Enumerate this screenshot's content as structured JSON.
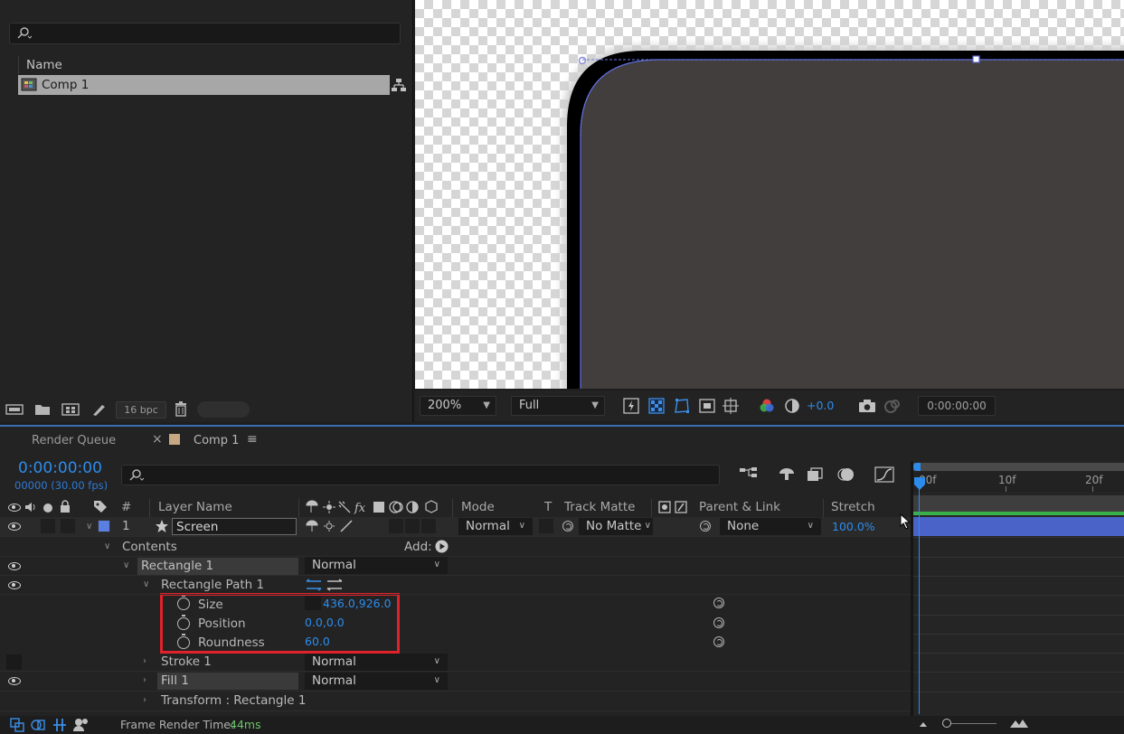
{
  "project": {
    "search_placeholder": "",
    "column_name": "Name",
    "item_label": "Comp 1",
    "bpc": "16 bpc"
  },
  "viewer": {
    "zoom": "200%",
    "resolution": "Full",
    "exposure": "+0.0",
    "timecode": "0:00:00:00"
  },
  "timeline": {
    "tabs": {
      "render_queue": "Render Queue",
      "comp": "Comp 1"
    },
    "timecode": "0:00:00:00",
    "fps": "00000 (30.00 fps)",
    "columns": {
      "num": "#",
      "layer_name": "Layer Name",
      "mode": "Mode",
      "t": "T",
      "track_matte": "Track Matte",
      "parent_link": "Parent & Link",
      "stretch": "Stretch"
    },
    "ruler": {
      "f0": "00f",
      "f10": "10f",
      "f20": "20f"
    },
    "layer": {
      "number": "1",
      "name": "Screen",
      "mode": "Normal",
      "matte": "No Matte",
      "parent": "None",
      "stretch": "100.0%"
    },
    "contents_label": "Contents",
    "add_label": "Add:",
    "rect_group": {
      "name": "Rectangle 1",
      "mode": "Normal"
    },
    "rect_path": {
      "name": "Rectangle Path 1"
    },
    "props": [
      {
        "name": "Size",
        "value": "436.0,926.0"
      },
      {
        "name": "Position",
        "value": "0.0,0.0"
      },
      {
        "name": "Roundness",
        "value": "60.0"
      }
    ],
    "stroke": {
      "name": "Stroke 1",
      "mode": "Normal"
    },
    "fill": {
      "name": "Fill 1",
      "mode": "Normal"
    },
    "transform": {
      "name": "Transform : Rectangle 1"
    },
    "status": {
      "label": "Frame Render Time:",
      "value": "44ms"
    }
  },
  "colors": {
    "accent": "#2d8ceb",
    "highlight_box": "#e0222a",
    "layer_bar": "#4a63c8",
    "layer_label": "#5b7fe0"
  }
}
